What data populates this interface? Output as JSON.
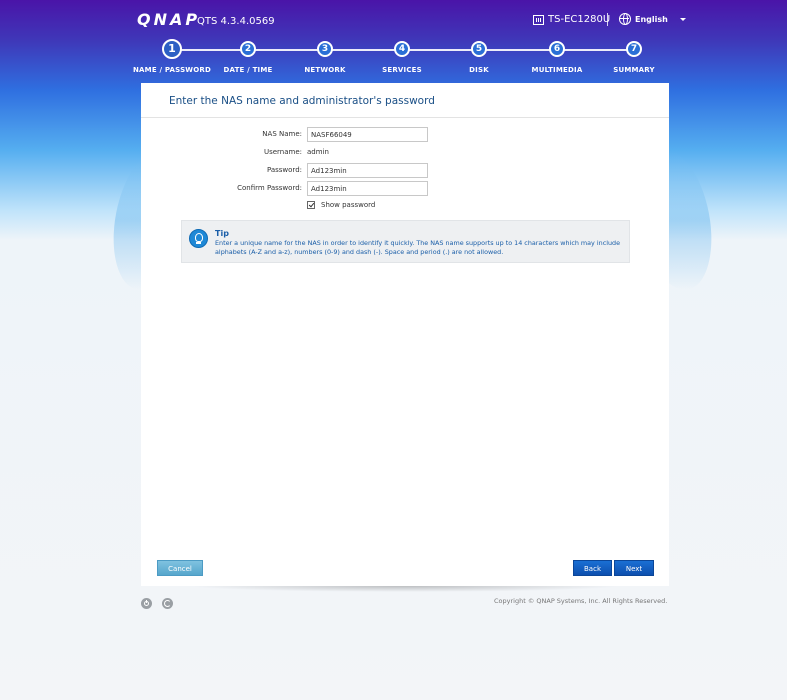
{
  "header": {
    "logo": "QNAP",
    "version": "QTS 4.3.4.0569",
    "model": "TS-EC1280U",
    "language": "English"
  },
  "steps": [
    {
      "number": "1",
      "label": "NAME / PASSWORD",
      "active": true
    },
    {
      "number": "2",
      "label": "DATE / TIME",
      "active": false
    },
    {
      "number": "3",
      "label": "NETWORK",
      "active": false
    },
    {
      "number": "4",
      "label": "SERVICES",
      "active": false
    },
    {
      "number": "5",
      "label": "DISK",
      "active": false
    },
    {
      "number": "6",
      "label": "MULTIMEDIA",
      "active": false
    },
    {
      "number": "7",
      "label": "SUMMARY",
      "active": false
    }
  ],
  "panel": {
    "title": "Enter the NAS name and administrator's password",
    "form": {
      "nas_name_label": "NAS Name:",
      "nas_name_value": "NASF66049",
      "username_label": "Username:",
      "username_value": "admin",
      "password_label": "Password:",
      "password_value": "Ad123min",
      "confirm_label": "Confirm Password:",
      "confirm_value": "Ad123min",
      "show_password_label": "Show password",
      "show_password_checked": true
    },
    "tip": {
      "title": "Tip",
      "text": "Enter a unique name for the NAS in order to identify it quickly. The NAS name supports up to 14 characters which may include alphabets (A-Z and a-z), numbers (0-9) and dash (-). Space and period (.) are not allowed."
    },
    "buttons": {
      "cancel": "Cancel",
      "back": "Back",
      "next": "Next"
    }
  },
  "footer": {
    "copyright": "Copyright © QNAP Systems, Inc. All Rights Reserved."
  },
  "colors": {
    "accent": "#1a6fd4",
    "title": "#1a4f86",
    "tip_text": "#1a5ea8",
    "cancel": "#6bb4d8"
  },
  "icons": [
    "server-icon",
    "globe-icon",
    "chevron-down-icon",
    "lightbulb-icon",
    "checkbox-icon",
    "power-icon",
    "restart-icon"
  ]
}
